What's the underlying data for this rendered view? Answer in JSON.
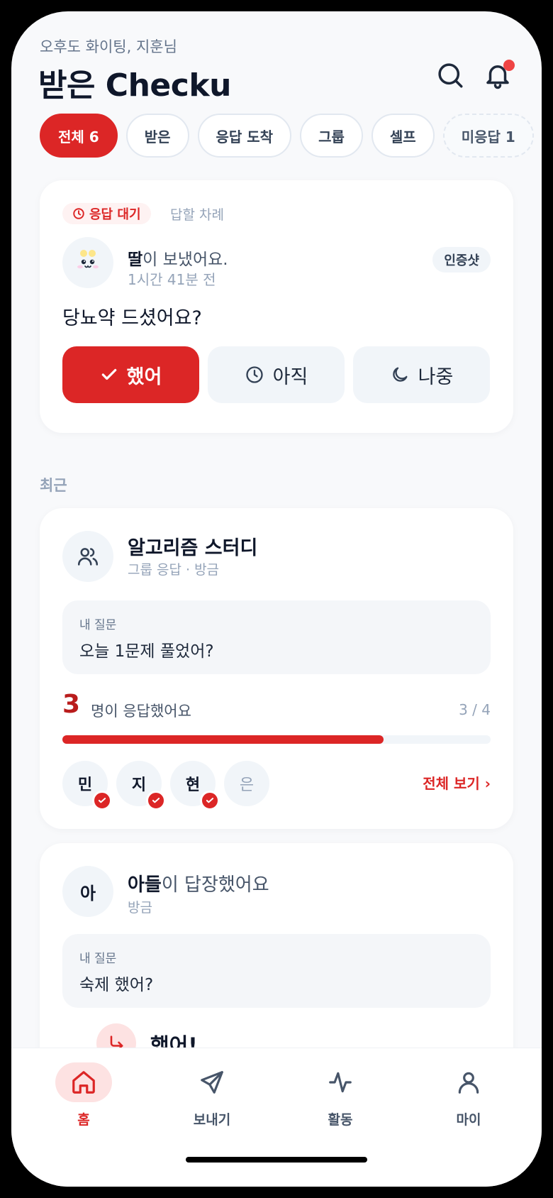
{
  "header": {
    "greeting": "오후도 화이팅, 지훈님",
    "title": "받은 Checku"
  },
  "filters": [
    {
      "label": "전체 6",
      "active": true
    },
    {
      "label": "받은"
    },
    {
      "label": "응답 도착"
    },
    {
      "label": "그룹"
    },
    {
      "label": "셀프"
    },
    {
      "label": "미응답 1",
      "dashed": true
    }
  ],
  "pending_card": {
    "status": "응답 대기",
    "status_note": "답할 차례",
    "sender_name": "딸",
    "sender_suffix": "이 보냈어요.",
    "time": "1시간 41분 전",
    "badge": "인증샷",
    "question": "당뇨약 드셨어요?",
    "buttons": {
      "done": "했어",
      "notyet": "아직",
      "later": "나중"
    }
  },
  "section_title": "최근",
  "group_card": {
    "name": "알고리즘 스터디",
    "sub": "그룹 응답 · 방금",
    "question_label": "내 질문",
    "question": "오늘 1문제 풀었어?",
    "count": "3",
    "count_label": "명이 응답했어요",
    "ratio": "3 / 4",
    "progress": 0.75,
    "members": [
      {
        "initial": "민",
        "done": true
      },
      {
        "initial": "지",
        "done": true
      },
      {
        "initial": "현",
        "done": true
      },
      {
        "initial": "은",
        "done": false
      }
    ],
    "see_all": "전체 보기 ›"
  },
  "reply_card": {
    "avatar": "아",
    "name": "아들",
    "suffix": "이 답장했어요",
    "time": "방금",
    "question_label": "내 질문",
    "question": "숙제 했어?",
    "reply": "했어!"
  },
  "tabs": {
    "home": "홈",
    "send": "보내기",
    "activity": "활동",
    "my": "마이"
  },
  "colors": {
    "accent": "#dc2626",
    "background": "#f8f9fb"
  }
}
